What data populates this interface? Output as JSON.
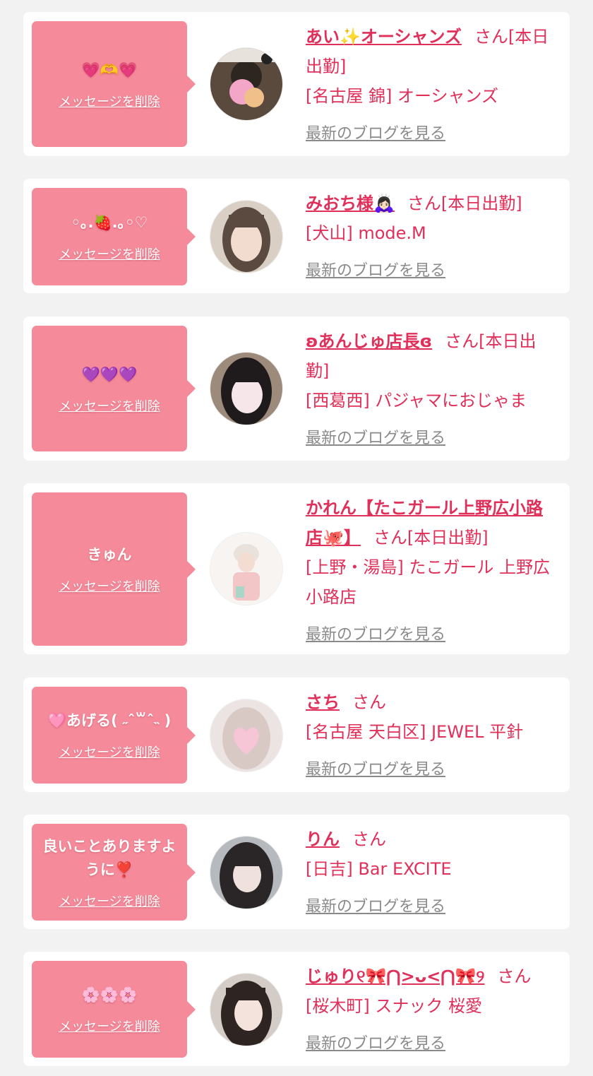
{
  "cards": [
    {
      "message": "💗🫶💗",
      "delete_label": "メッセージを削除",
      "name": "あい✨オーシャンズ",
      "honorific": "さん",
      "status": "[本日出勤]",
      "shop": "[名古屋 錦] オーシャンズ",
      "blog_link": "最新のブログを見る"
    },
    {
      "message": "◦｡.🍓.｡◦♡",
      "delete_label": "メッセージを削除",
      "name": "みおち様🙇🏻‍♀️",
      "honorific": "さん",
      "status": "[本日出勤]",
      "shop": "[犬山] mode.M",
      "blog_link": "最新のブログを見る"
    },
    {
      "message": "💜💜💜",
      "delete_label": "メッセージを削除",
      "name": "ʚあんじゅ店長ɞ",
      "honorific": "さん",
      "status": "[本日出勤]",
      "shop": "[西葛西] パジャマにおじゃま",
      "blog_link": "最新のブログを見る"
    },
    {
      "message": "きゅん",
      "delete_label": "メッセージを削除",
      "name": "かれん【たこガール上野広小路店🐙】",
      "honorific": "さん",
      "status": "[本日出勤]",
      "shop": "[上野・湯島] たこガール 上野広小路店",
      "blog_link": "最新のブログを見る"
    },
    {
      "message": "🩷あげる( ˶ˆ꒳ˆ˵ )",
      "delete_label": "メッセージを削除",
      "name": "さち",
      "honorific": "さん",
      "status": "",
      "shop": "[名古屋 天白区] JEWEL 平針",
      "blog_link": "最新のブログを見る"
    },
    {
      "message": "良いことありますように❣️",
      "delete_label": "メッセージを削除",
      "name": "りん",
      "honorific": "さん",
      "status": "",
      "shop": "[日吉] Bar EXCITE",
      "blog_link": "最新のブログを見る"
    },
    {
      "message": "🌸🌸🌸",
      "delete_label": "メッセージを削除",
      "name": "じゅり୧🎀⋂>ᴗ<⋂🎀୨",
      "honorific": "さん",
      "status": "",
      "shop": "[桜木町] スナック 桜愛",
      "blog_link": "最新のブログを見る"
    }
  ],
  "colors": {
    "accent": "#e0305a",
    "bubble": "#f58a9a",
    "link_gray": "#8a8a8a",
    "background": "#f2f2f2"
  }
}
